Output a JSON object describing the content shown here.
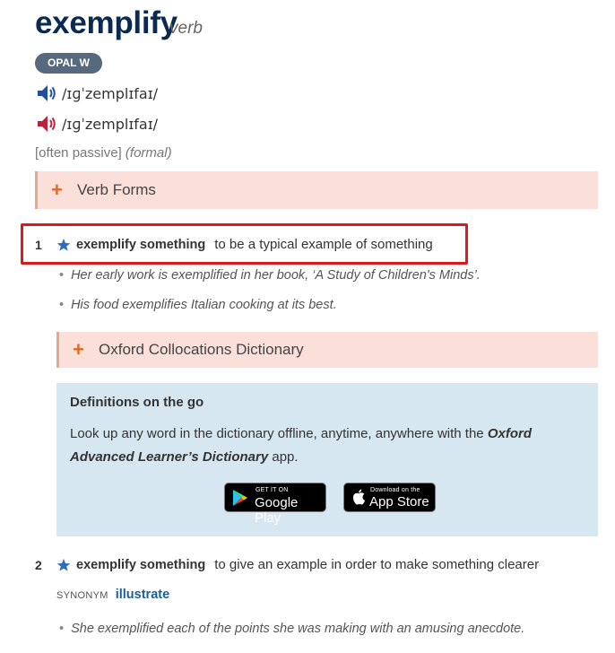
{
  "entry": {
    "headword": "exemplify",
    "pos": "verb",
    "opal_badge": "OPAL W",
    "pron_uk": "/ɪɡˈzemplɪfaɪ/",
    "pron_us": "/ɪɡˈzemplɪfaɪ/",
    "grammar_label": "[often passive]",
    "register_label": "(formal)",
    "verb_forms_label": "Verb Forms"
  },
  "senses": [
    {
      "number": "1",
      "cf": "exemplify something",
      "definition": "to be a typical example of something",
      "examples": [
        "Her early work is exemplified in her book, ‘A Study of Children's Minds’.",
        "His food exemplifies Italian cooking at its best."
      ],
      "collocations_label": "Oxford Collocations Dictionary"
    },
    {
      "number": "2",
      "cf": "exemplify something",
      "definition": "to give an example in order to make something clearer",
      "synonym_label": "SYNONYM",
      "synonym": "illustrate",
      "examples": [
        "She exemplified each of the points she was making with an amusing anecdote."
      ]
    }
  ],
  "promo": {
    "title": "Definitions on the go",
    "text_before": "Look up any word in the dictionary offline, anytime, anywhere with the ",
    "app_name": "Oxford Advanced Learner’s Dictionary",
    "text_after": " app.",
    "google_small": "GET IT ON",
    "google_big": "Google Play",
    "apple_small": "Download on the",
    "apple_big": "App Store"
  },
  "colors": {
    "headword": "#0b2a52",
    "opal_badge_bg": "#56697f",
    "uk_speaker": "#1f4f9e",
    "us_speaker": "#b8243c",
    "collapse_bg": "#fbe0da",
    "plus": "#d86a2c",
    "star": "#2f6cbf",
    "promo_bg": "#d6e7f1",
    "highlight_box": "#dd1a1a",
    "synonym_link": "#1d5f9a"
  },
  "icons": [
    "speaker-uk-icon",
    "speaker-us-icon",
    "plus-icon",
    "star-icon",
    "google-play-icon",
    "apple-icon"
  ]
}
